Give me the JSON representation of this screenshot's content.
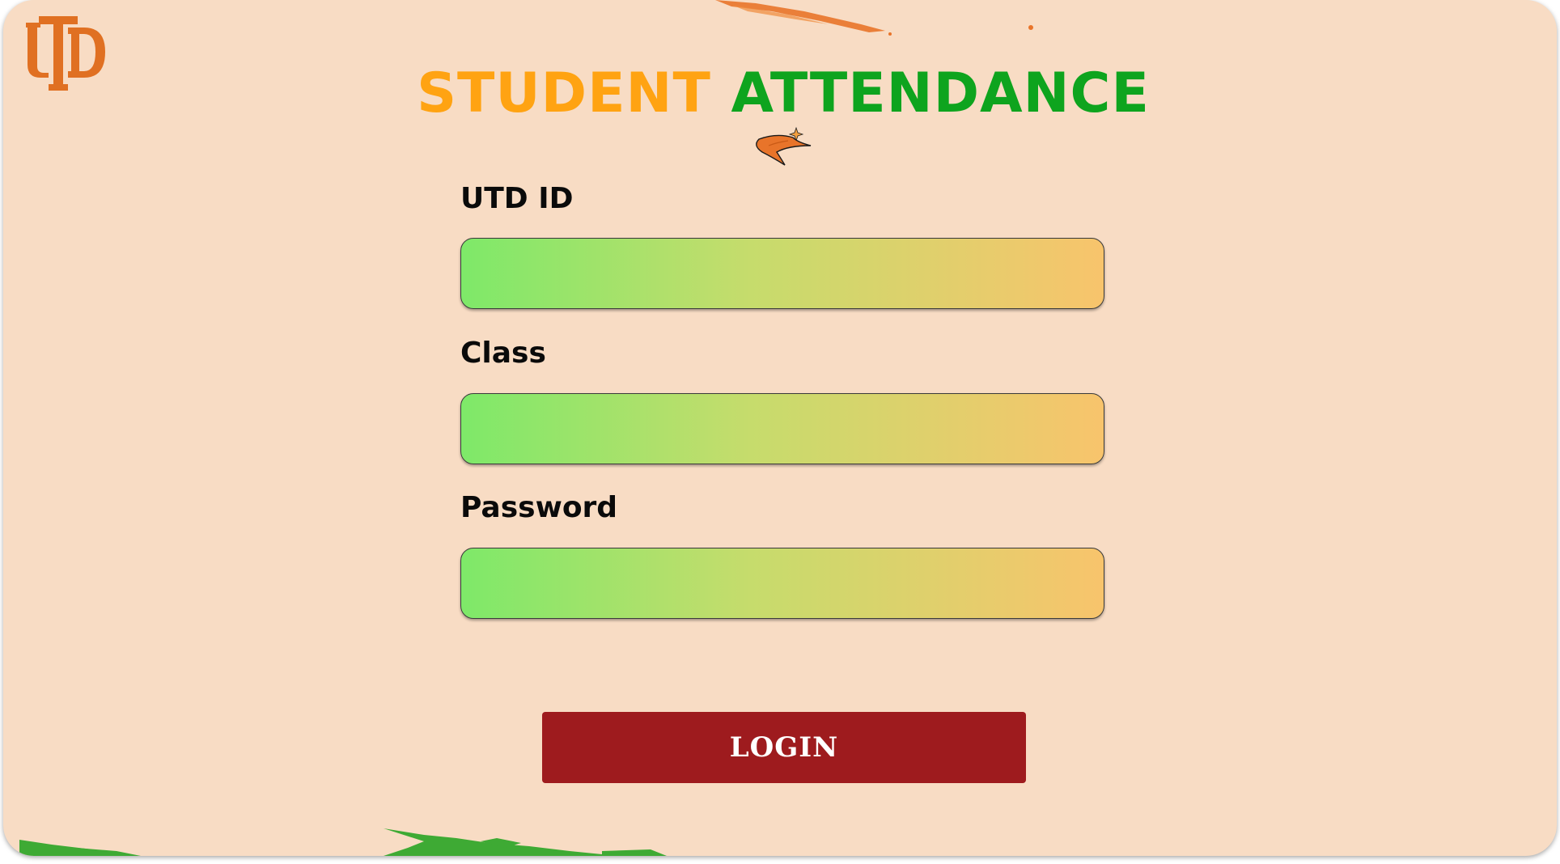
{
  "brand": {
    "logo_text": "UTD",
    "logo_color": "#e07022"
  },
  "header": {
    "title_part1": "STUDENT",
    "title_part2": "ATTENDANCE",
    "title_part1_color": "#ffa312",
    "title_part2_color": "#0ea41e",
    "emblem_icon": "comet-icon"
  },
  "form": {
    "fields": [
      {
        "label": "UTD ID",
        "value": ""
      },
      {
        "label": "Class",
        "value": ""
      },
      {
        "label": "Password",
        "value": ""
      }
    ],
    "submit_label": "LOGIN",
    "submit_color": "#9e1b1e"
  },
  "theme": {
    "background": "#f8dcc4",
    "input_gradient_start": "#7ee969",
    "input_gradient_end": "#f8c46c"
  }
}
